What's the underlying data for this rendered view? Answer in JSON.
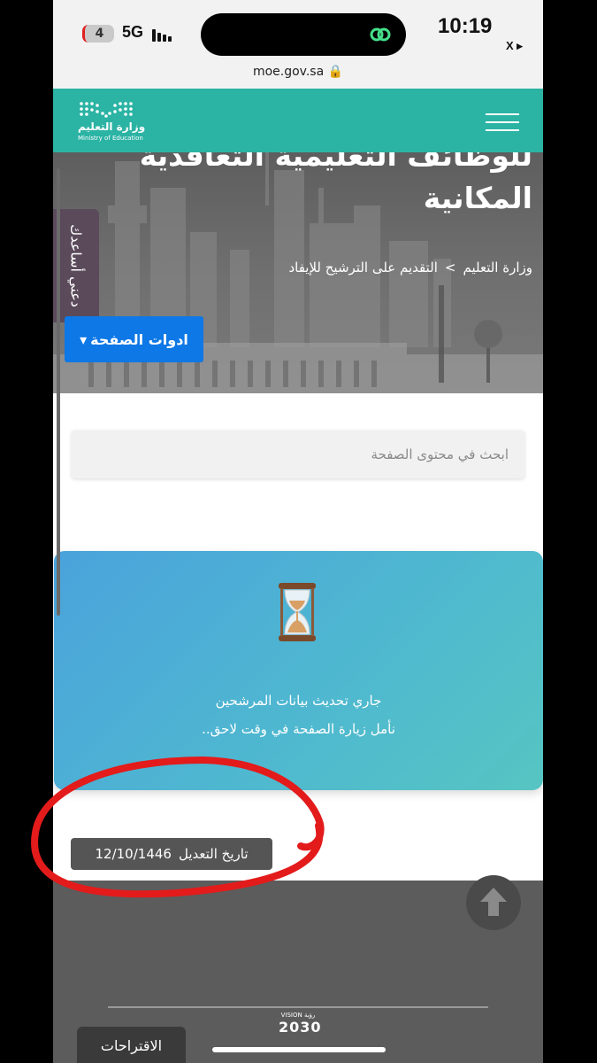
{
  "status_bar": {
    "battery": "4",
    "network": "5G",
    "time": "10:19",
    "back_app": "X ▸",
    "url": "moe.gov.sa 🔒"
  },
  "header": {
    "logo_ar": "وزارة التعليم",
    "logo_en": "Ministry of Education",
    "brand_color": "#2bb3a4"
  },
  "hero": {
    "title_line1": "للوظائف التعليمية التعاقدية",
    "title_line2": "المكانية",
    "breadcrumb": {
      "home": "وزارة التعليم",
      "separator": ">",
      "current": "التقديم على الترشيح للإيفاد"
    },
    "help_tab": "دعني أساعدك",
    "tools_button": "ادوات الصفحة",
    "tools_caret": "▾"
  },
  "search": {
    "placeholder": "ابحث في محتوى الصفحة"
  },
  "notice": {
    "line1": "جاري تحديث بيانات المرشحين",
    "line2": "نأمل زيارة الصفحة في وقت لاحق.."
  },
  "modified": {
    "label": "تاريخ التعديل",
    "date": "12/10/1446"
  },
  "footer": {
    "vision_top": "VISION رؤية",
    "vision_year": "2030",
    "suggestions": "الاقتراحات"
  },
  "colors": {
    "tools_button": "#0d78e6",
    "annotation": "#e31b1b"
  }
}
